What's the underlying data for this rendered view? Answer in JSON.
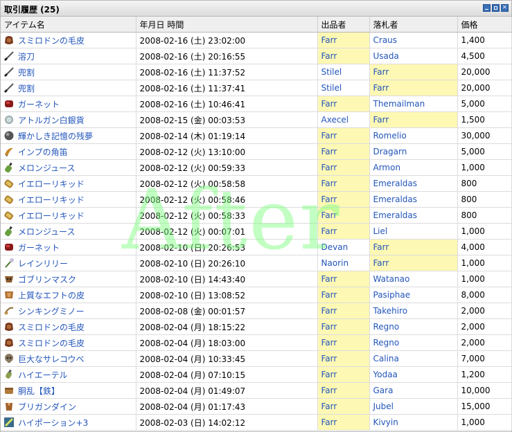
{
  "panel": {
    "title": "取引履歴 (25)",
    "buttons": [
      "minimize-icon",
      "restore-icon",
      "close-icon"
    ]
  },
  "columns": {
    "item": "アイテム名",
    "datetime": "年月日 時間",
    "seller": "出品者",
    "buyer": "落札者",
    "price": "価格"
  },
  "highlight_color": "#fdf8b4",
  "link_color": "#2255bb",
  "watermark": "After",
  "rows": [
    {
      "item": "スミロドンの毛皮",
      "icon": "pelt",
      "datetime": "2008-02-16 (土) 23:02:00",
      "seller": "Farr",
      "buyer": "Craus",
      "price": "1,400",
      "hl": "seller"
    },
    {
      "item": "溶刀",
      "icon": "sword",
      "datetime": "2008-02-16 (土) 20:16:55",
      "seller": "Farr",
      "buyer": "Usada",
      "price": "4,500",
      "hl": "seller"
    },
    {
      "item": "兜割",
      "icon": "sword",
      "datetime": "2008-02-16 (土) 11:37:52",
      "seller": "Stilel",
      "buyer": "Farr",
      "price": "20,000",
      "hl": "buyer"
    },
    {
      "item": "兜割",
      "icon": "sword",
      "datetime": "2008-02-16 (土) 11:37:41",
      "seller": "Stilel",
      "buyer": "Farr",
      "price": "20,000",
      "hl": "buyer"
    },
    {
      "item": "ガーネット",
      "icon": "gem",
      "datetime": "2008-02-16 (土) 10:46:41",
      "seller": "Farr",
      "buyer": "Themailman",
      "price": "5,000",
      "hl": "seller"
    },
    {
      "item": "アトルガン白銀貨",
      "icon": "coin",
      "datetime": "2008-02-15 (金) 00:03:53",
      "seller": "Axecel",
      "buyer": "Farr",
      "price": "1,500",
      "hl": "buyer"
    },
    {
      "item": "輝かしき記憶の残夢",
      "icon": "orb",
      "datetime": "2008-02-14 (木) 01:19:14",
      "seller": "Farr",
      "buyer": "Romelio",
      "price": "30,000",
      "hl": "seller"
    },
    {
      "item": "インプの角笛",
      "icon": "horn",
      "datetime": "2008-02-12 (火) 13:10:00",
      "seller": "Farr",
      "buyer": "Dragarn",
      "price": "5,000",
      "hl": "seller"
    },
    {
      "item": "メロンジュース",
      "icon": "bottle",
      "datetime": "2008-02-12 (火) 00:59:33",
      "seller": "Farr",
      "buyer": "Armon",
      "price": "1,000",
      "hl": "seller"
    },
    {
      "item": "イエローリキッド",
      "icon": "liquid",
      "datetime": "2008-02-12 (火) 00:58:58",
      "seller": "Farr",
      "buyer": "Emeraldas",
      "price": "800",
      "hl": "seller"
    },
    {
      "item": "イエローリキッド",
      "icon": "liquid",
      "datetime": "2008-02-12 (火) 00:58:46",
      "seller": "Farr",
      "buyer": "Emeraldas",
      "price": "800",
      "hl": "seller"
    },
    {
      "item": "イエローリキッド",
      "icon": "liquid",
      "datetime": "2008-02-12 (火) 00:58:33",
      "seller": "Farr",
      "buyer": "Emeraldas",
      "price": "800",
      "hl": "seller"
    },
    {
      "item": "メロンジュース",
      "icon": "bottle",
      "datetime": "2008-02-12 (火) 00:07:01",
      "seller": "Farr",
      "buyer": "Liel",
      "price": "1,000",
      "hl": "seller"
    },
    {
      "item": "ガーネット",
      "icon": "gem",
      "datetime": "2008-02-10 (日) 20:26:53",
      "seller": "Devan",
      "buyer": "Farr",
      "price": "4,000",
      "hl": "buyer"
    },
    {
      "item": "レインリリー",
      "icon": "flower",
      "datetime": "2008-02-10 (日) 20:26:10",
      "seller": "Naorin",
      "buyer": "Farr",
      "price": "1,000",
      "hl": "buyer"
    },
    {
      "item": "ゴブリンマスク",
      "icon": "mask",
      "datetime": "2008-02-10 (日) 14:43:40",
      "seller": "Farr",
      "buyer": "Watanao",
      "price": "1,000",
      "hl": "seller"
    },
    {
      "item": "上質なエフトの皮",
      "icon": "hide",
      "datetime": "2008-02-10 (日) 13:08:52",
      "seller": "Farr",
      "buyer": "Pasiphae",
      "price": "8,000",
      "hl": "seller"
    },
    {
      "item": "シンキングミノー",
      "icon": "lure",
      "datetime": "2008-02-08 (金) 00:01:57",
      "seller": "Farr",
      "buyer": "Takehiro",
      "price": "2,000",
      "hl": "seller"
    },
    {
      "item": "スミロドンの毛皮",
      "icon": "pelt",
      "datetime": "2008-02-04 (月) 18:15:22",
      "seller": "Farr",
      "buyer": "Regno",
      "price": "2,000",
      "hl": "seller"
    },
    {
      "item": "スミロドンの毛皮",
      "icon": "pelt",
      "datetime": "2008-02-04 (月) 18:03:00",
      "seller": "Farr",
      "buyer": "Regno",
      "price": "2,000",
      "hl": "seller"
    },
    {
      "item": "巨大なサレコウベ",
      "icon": "skull",
      "datetime": "2008-02-04 (月) 10:33:45",
      "seller": "Farr",
      "buyer": "Calina",
      "price": "7,000",
      "hl": "seller"
    },
    {
      "item": "ハイエーテル",
      "icon": "potion",
      "datetime": "2008-02-04 (月) 07:10:15",
      "seller": "Farr",
      "buyer": "Yodaa",
      "price": "1,200",
      "hl": "seller"
    },
    {
      "item": "胴乱【鉄】",
      "icon": "box",
      "datetime": "2008-02-04 (月) 01:49:07",
      "seller": "Farr",
      "buyer": "Gara",
      "price": "10,000",
      "hl": "seller"
    },
    {
      "item": "ブリガンダイン",
      "icon": "armor",
      "datetime": "2008-02-04 (月) 01:17:43",
      "seller": "Farr",
      "buyer": "Jubel",
      "price": "15,000",
      "hl": "seller"
    },
    {
      "item": "ハイポーション+3",
      "icon": "scroll",
      "datetime": "2008-02-03 (日) 14:02:12",
      "seller": "Farr",
      "buyer": "Kivyin",
      "price": "1,000",
      "hl": "seller"
    }
  ]
}
